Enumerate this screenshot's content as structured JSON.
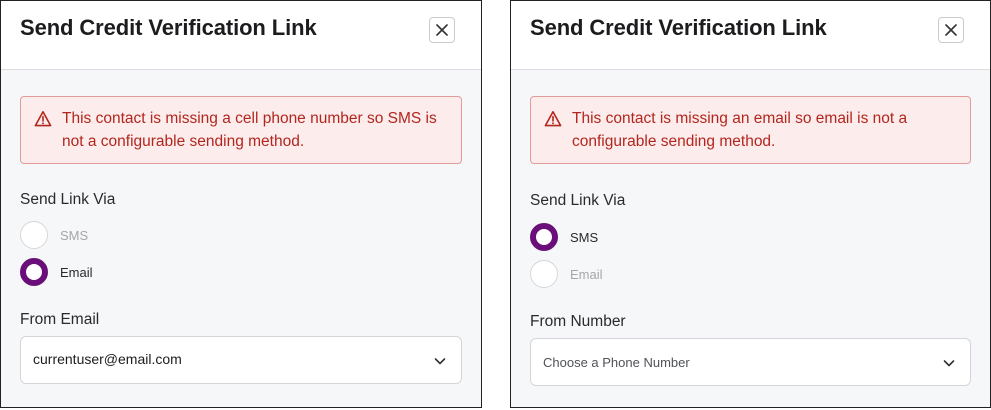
{
  "left": {
    "title": "Send Credit Verification Link",
    "alert": "This contact is missing a cell phone number so SMS is not a configurable sending method.",
    "send_via_label": "Send Link Via",
    "options": [
      {
        "label": "SMS",
        "checked": false,
        "disabled": true
      },
      {
        "label": "Email",
        "checked": true,
        "disabled": false
      }
    ],
    "from_label": "From Email",
    "from_value": "currentuser@email.com"
  },
  "right": {
    "title": "Send Credit Verification Link",
    "alert": "This contact is missing an email so email is not a configurable sending method.",
    "send_via_label": "Send Link Via",
    "options": [
      {
        "label": "SMS",
        "checked": true,
        "disabled": false
      },
      {
        "label": "Email",
        "checked": false,
        "disabled": true
      }
    ],
    "from_label": "From Number",
    "from_placeholder": "Choose a Phone Number"
  },
  "colors": {
    "accent": "#6a0f7a",
    "error_text": "#b3261e",
    "error_bg": "#fcecec",
    "error_border": "#e29a9a"
  },
  "icons": {
    "close": "close-icon",
    "warning": "warning-icon",
    "chevron": "chevron-down-icon"
  }
}
